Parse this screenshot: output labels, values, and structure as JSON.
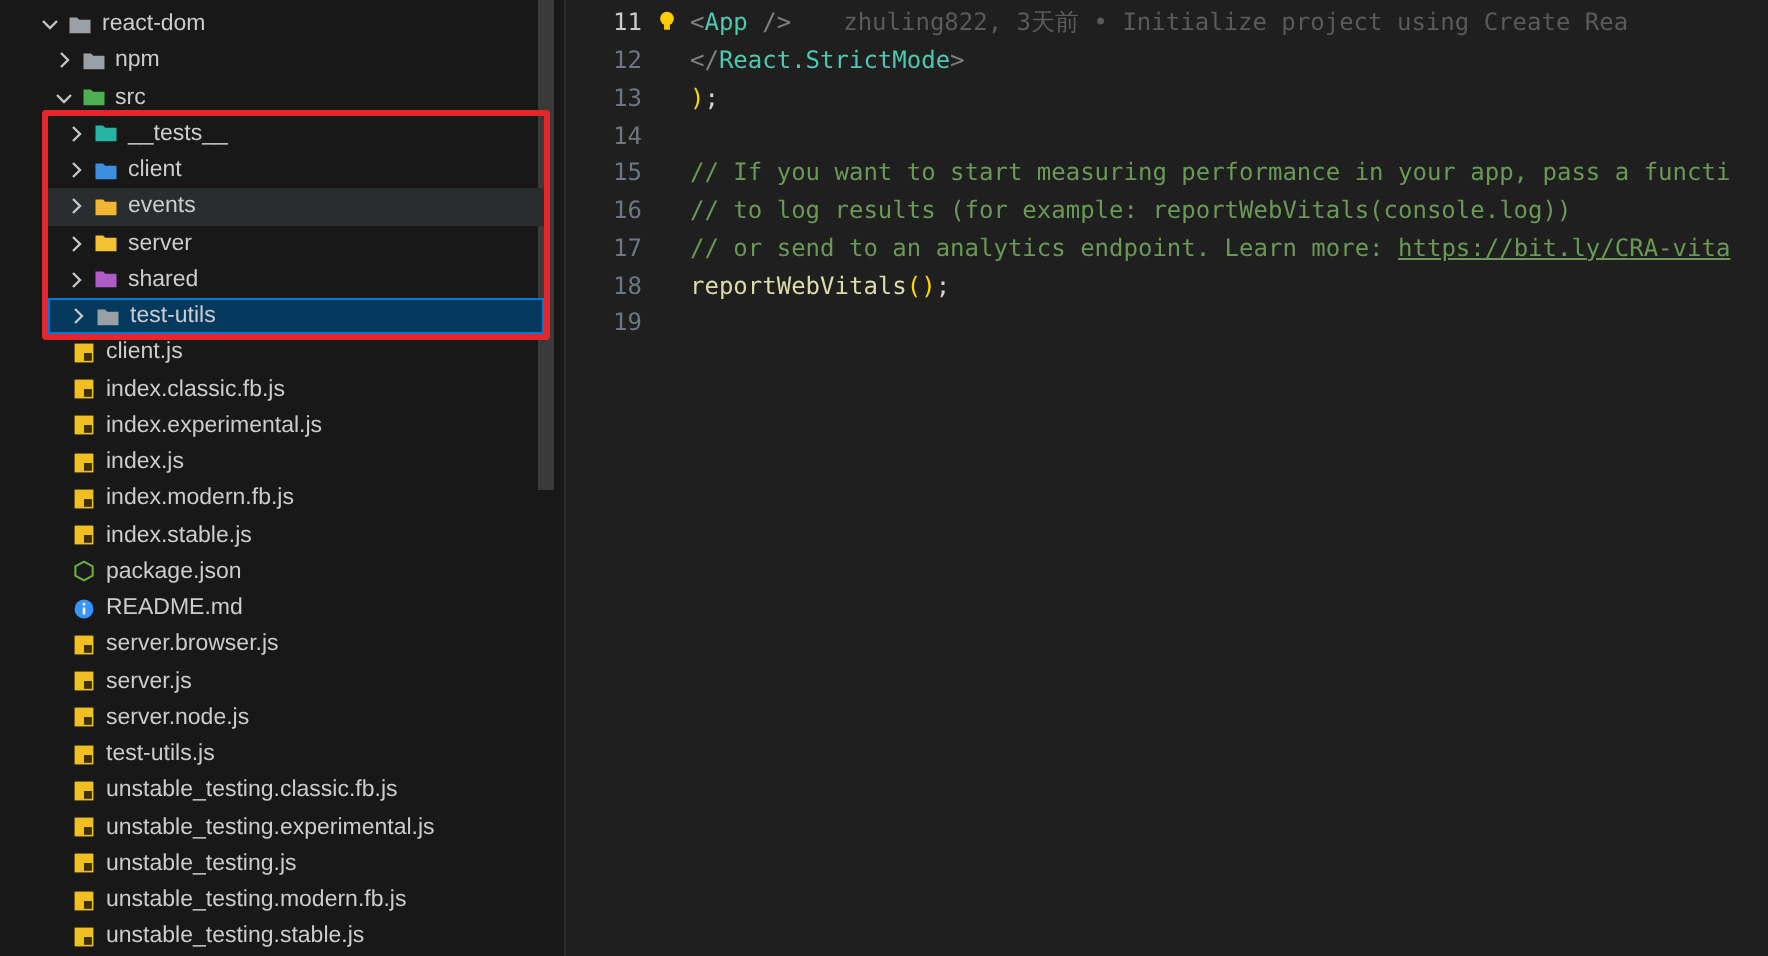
{
  "sidebar": {
    "tree": [
      {
        "label": "react-dom",
        "kind": "folder",
        "color": "#9aa0a6",
        "expanded": true,
        "selected": false,
        "hovered": false,
        "highlighted": false,
        "children": [
          {
            "label": "npm",
            "kind": "folder",
            "color": "#9aa0a6",
            "expanded": false,
            "selected": false,
            "hovered": false,
            "highlighted": false
          },
          {
            "label": "src",
            "kind": "folder",
            "color": "#4caf50",
            "expanded": true,
            "selected": false,
            "hovered": false,
            "highlighted": false,
            "children": [
              {
                "label": "__tests__",
                "kind": "folder",
                "color": "#26b5a0",
                "expanded": false,
                "selected": false,
                "hovered": false,
                "highlighted": true
              },
              {
                "label": "client",
                "kind": "folder",
                "color": "#3e8ee0",
                "expanded": false,
                "selected": false,
                "hovered": false,
                "highlighted": true
              },
              {
                "label": "events",
                "kind": "folder",
                "color": "#f2b632",
                "expanded": false,
                "selected": false,
                "hovered": true,
                "highlighted": true
              },
              {
                "label": "server",
                "kind": "folder",
                "color": "#f2c232",
                "expanded": false,
                "selected": false,
                "hovered": false,
                "highlighted": true
              },
              {
                "label": "shared",
                "kind": "folder",
                "color": "#b05cc8",
                "expanded": false,
                "selected": false,
                "hovered": false,
                "highlighted": true
              },
              {
                "label": "test-utils",
                "kind": "folder",
                "color": "#9aa0a6",
                "expanded": false,
                "selected": true,
                "hovered": false,
                "highlighted": true
              },
              {
                "label": "client.js",
                "kind": "js",
                "selected": false,
                "hovered": false,
                "highlighted": false
              },
              {
                "label": "index.classic.fb.js",
                "kind": "js",
                "selected": false,
                "hovered": false,
                "highlighted": false
              },
              {
                "label": "index.experimental.js",
                "kind": "js",
                "selected": false,
                "hovered": false,
                "highlighted": false
              },
              {
                "label": "index.js",
                "kind": "js",
                "selected": false,
                "hovered": false,
                "highlighted": false
              },
              {
                "label": "index.modern.fb.js",
                "kind": "js",
                "selected": false,
                "hovered": false,
                "highlighted": false
              },
              {
                "label": "index.stable.js",
                "kind": "js",
                "selected": false,
                "hovered": false,
                "highlighted": false
              },
              {
                "label": "package.json",
                "kind": "json",
                "selected": false,
                "hovered": false,
                "highlighted": false
              },
              {
                "label": "README.md",
                "kind": "info",
                "selected": false,
                "hovered": false,
                "highlighted": false
              },
              {
                "label": "server.browser.js",
                "kind": "js",
                "selected": false,
                "hovered": false,
                "highlighted": false
              },
              {
                "label": "server.js",
                "kind": "js",
                "selected": false,
                "hovered": false,
                "highlighted": false
              },
              {
                "label": "server.node.js",
                "kind": "js",
                "selected": false,
                "hovered": false,
                "highlighted": false
              },
              {
                "label": "test-utils.js",
                "kind": "js",
                "selected": false,
                "hovered": false,
                "highlighted": false
              },
              {
                "label": "unstable_testing.classic.fb.js",
                "kind": "js",
                "selected": false,
                "hovered": false,
                "highlighted": false
              },
              {
                "label": "unstable_testing.experimental.js",
                "kind": "js",
                "selected": false,
                "hovered": false,
                "highlighted": false
              },
              {
                "label": "unstable_testing.js",
                "kind": "js",
                "selected": false,
                "hovered": false,
                "highlighted": false
              },
              {
                "label": "unstable_testing.modern.fb.js",
                "kind": "js",
                "selected": false,
                "hovered": false,
                "highlighted": false
              },
              {
                "label": "unstable_testing.stable.js",
                "kind": "js",
                "selected": false,
                "hovered": false,
                "highlighted": false
              }
            ]
          }
        ]
      }
    ]
  },
  "editor": {
    "lines": [
      {
        "number": "11",
        "current": true,
        "lightbulb": true,
        "tokens": [
          {
            "text": "<",
            "kind": "punct"
          },
          {
            "text": "App",
            "kind": "tag"
          },
          {
            "text": " />",
            "kind": "punct"
          }
        ],
        "blame": "zhuling822, 3天前 • Initialize project using Create Rea"
      },
      {
        "number": "12",
        "current": false,
        "lightbulb": false,
        "tokens": [
          {
            "text": "</",
            "kind": "punct"
          },
          {
            "text": "React.StrictMode",
            "kind": "tag"
          },
          {
            "text": ">",
            "kind": "punct"
          }
        ]
      },
      {
        "number": "13",
        "current": false,
        "lightbulb": false,
        "tokens": [
          {
            "text": ")",
            "kind": "paren"
          },
          {
            "text": ";",
            "kind": "plain"
          }
        ]
      },
      {
        "number": "14",
        "current": false,
        "lightbulb": false
      },
      {
        "number": "15",
        "current": false,
        "lightbulb": false,
        "tokens": [
          {
            "text": "// If you want to start measuring performance in your app, pass a functi",
            "kind": "comment"
          }
        ]
      },
      {
        "number": "16",
        "current": false,
        "lightbulb": false,
        "tokens": [
          {
            "text": "// to log results (for example: reportWebVitals(console.log))",
            "kind": "comment"
          }
        ]
      },
      {
        "number": "17",
        "current": false,
        "lightbulb": false,
        "tokens": [
          {
            "text": "// or send to an analytics endpoint. Learn more: ",
            "kind": "comment"
          },
          {
            "text": "https://bit.ly/CRA-vita",
            "kind": "link"
          }
        ]
      },
      {
        "number": "18",
        "current": false,
        "lightbulb": false,
        "tokens": [
          {
            "text": "reportWebVitals",
            "kind": "func"
          },
          {
            "text": "()",
            "kind": "paren"
          },
          {
            "text": ";",
            "kind": "plain"
          }
        ]
      },
      {
        "number": "19",
        "current": false,
        "lightbulb": false
      }
    ]
  }
}
